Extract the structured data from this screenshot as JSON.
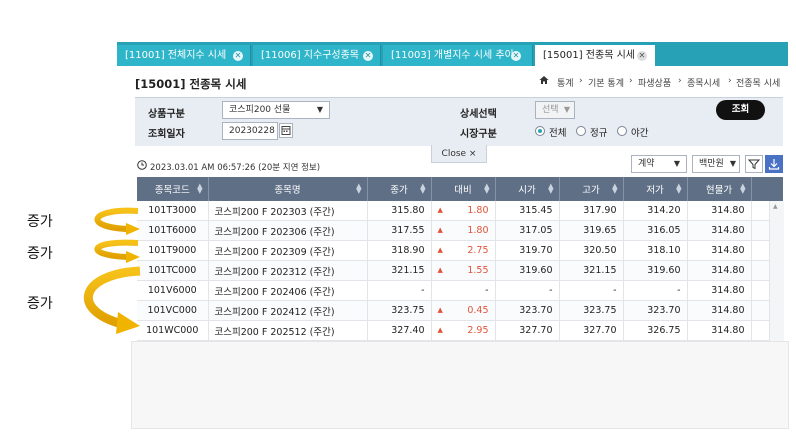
{
  "tabs": [
    {
      "label": "[11001] 전체지수 시세"
    },
    {
      "label": "[11006] 지수구성종목"
    },
    {
      "label": "[11003] 개별지수 시세 추이"
    },
    {
      "label": "[15001] 전종목 시세"
    }
  ],
  "page_title": "[15001] 전종목 시세",
  "breadcrumb": [
    "통계",
    "기본 통계",
    "파생상품",
    "종목시세",
    "전종목 시세"
  ],
  "filter": {
    "product_label": "상품구분",
    "product_value": "코스피200 선물",
    "date_label": "조회일자",
    "date_value": "20230228",
    "detail_label": "상세선택",
    "detail_value": "선택",
    "market_label": "시장구분",
    "market_options": [
      "전체",
      "정규",
      "야간"
    ],
    "search_button": "조회"
  },
  "close_label": "Close ×",
  "timestamp": "2023.03.01 AM 06:57:26 (20분 지연 정보)",
  "view_select": "계약",
  "unit_select": "백만원",
  "table": {
    "headers": [
      "종목코드",
      "종목명",
      "종가",
      "대비",
      "시가",
      "고가",
      "저가",
      "현물가"
    ],
    "rows": [
      {
        "code": "101T3000",
        "name": "코스피200 F 202303 (주간)",
        "close": "315.80",
        "change": "1.80",
        "open": "315.45",
        "high": "317.90",
        "low": "314.20",
        "spot": "314.80"
      },
      {
        "code": "101T6000",
        "name": "코스피200 F 202306 (주간)",
        "close": "317.55",
        "change": "1.80",
        "open": "317.05",
        "high": "319.65",
        "low": "316.05",
        "spot": "314.80"
      },
      {
        "code": "101T9000",
        "name": "코스피200 F 202309 (주간)",
        "close": "318.90",
        "change": "2.75",
        "open": "319.70",
        "high": "320.50",
        "low": "318.10",
        "spot": "314.80"
      },
      {
        "code": "101TC000",
        "name": "코스피200 F 202312 (주간)",
        "close": "321.15",
        "change": "1.55",
        "open": "319.60",
        "high": "321.15",
        "low": "319.60",
        "spot": "314.80"
      },
      {
        "code": "101V6000",
        "name": "코스피200 F 202406 (주간)",
        "close": "-",
        "change": "-",
        "open": "-",
        "high": "-",
        "low": "-",
        "spot": "314.80"
      },
      {
        "code": "101VC000",
        "name": "코스피200 F 202412 (주간)",
        "close": "323.75",
        "change": "0.45",
        "open": "323.70",
        "high": "323.75",
        "low": "323.70",
        "spot": "314.80"
      },
      {
        "code": "101WC000",
        "name": "코스피200 F 202512 (주간)",
        "close": "327.40",
        "change": "2.95",
        "open": "327.70",
        "high": "327.70",
        "low": "326.75",
        "spot": "314.80"
      }
    ]
  },
  "annotations": [
    "증가",
    "증가",
    "증가"
  ],
  "colors": {
    "tab_bar": "#26a1b6",
    "header": "#5f6f86",
    "up": "#e0553a",
    "arrow": "#f0b400"
  }
}
